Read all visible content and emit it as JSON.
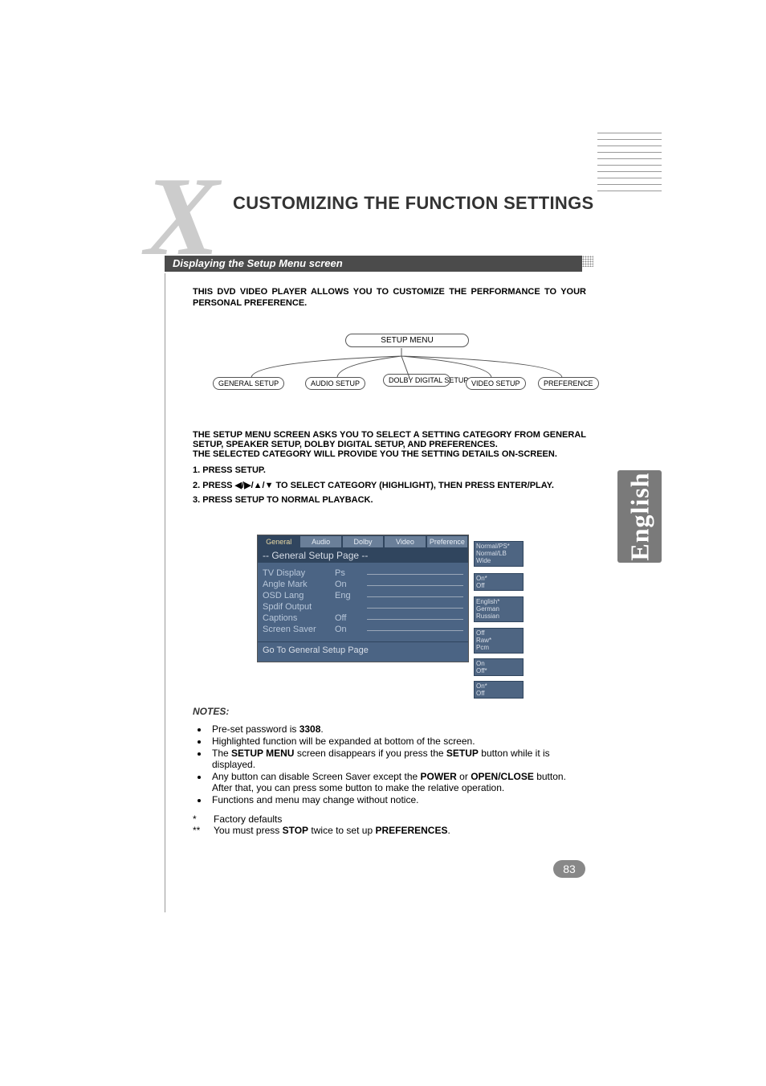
{
  "title": "CUSTOMIZING THE FUNCTION SETTINGS",
  "subtitle": "Displaying the Setup Menu screen",
  "intro": "THIS DVD VIDEO PLAYER ALLOWS YOU TO CUSTOMIZE THE PERFORMANCE TO YOUR PERSONAL PREFERENCE.",
  "tree": {
    "root": "SETUP MENU",
    "leaves": [
      "GENERAL SETUP",
      "AUDIO SETUP",
      "DOLBY DIGITAL SETUP",
      "VIDEO SETUP",
      "PREFERENCE"
    ]
  },
  "body": {
    "para1": "THE SETUP MENU SCREEN ASKS YOU TO SELECT A SETTING CATEGORY FROM GENERAL SETUP, SPEAKER SETUP, DOLBY DIGITAL SETUP, AND PREFERENCES.",
    "para2": "THE SELECTED CATEGORY WILL PROVIDE YOU THE SETTING DETAILS ON-SCREEN.",
    "step1": "1. PRESS SETUP.",
    "step2_pre": "2. PRESS ",
    "step2_post": " TO SELECT CATEGORY (HIGHLIGHT), THEN PRESS ENTER/PLAY.",
    "step3": "3. PRESS SETUP TO NORMAL PLAYBACK."
  },
  "ui": {
    "tabs": [
      "General",
      "Audio",
      "Dolby",
      "Video",
      "Preference"
    ],
    "header": "-- General Setup Page --",
    "rows": [
      {
        "label": "TV Display",
        "value": "Ps"
      },
      {
        "label": "Angle Mark",
        "value": "On"
      },
      {
        "label": "OSD Lang",
        "value": "Eng"
      },
      {
        "label": "Spdif Output",
        "value": ""
      },
      {
        "label": "Captions",
        "value": "Off"
      },
      {
        "label": "Screen Saver",
        "value": "On"
      }
    ],
    "footer": "Go To General Setup Page",
    "opts": [
      [
        "Normal/PS*",
        "Normal/LB",
        "Wide"
      ],
      [
        "On*",
        "Off"
      ],
      [
        "English*",
        "German",
        "Russian"
      ],
      [
        "Off",
        "Raw*",
        "Pcm"
      ],
      [
        "On",
        "Off*"
      ],
      [
        "On*",
        "Off"
      ]
    ]
  },
  "notes": {
    "head": "NOTES:",
    "items": [
      {
        "pre": "Pre-set password is ",
        "bold": "3308",
        "post": "."
      },
      {
        "pre": "Highlighted function will be expanded at bottom of the screen.",
        "bold": "",
        "post": ""
      },
      {
        "pre": "The ",
        "bold": "SETUP MENU",
        "mid": " screen disappears if you press the ",
        "bold2": "SETUP",
        "post": " button while it is displayed."
      },
      {
        "pre": "Any button can disable Screen Saver except the ",
        "bold": "POWER",
        "mid": " or ",
        "bold2": "OPEN/CLOSE",
        "post": " button. After that, you can press some button to make the relative operation."
      },
      {
        "pre": "Functions and menu may change without notice.",
        "bold": "",
        "post": ""
      }
    ],
    "defs": [
      {
        "mark": "*",
        "text": "Factory defaults"
      },
      {
        "mark": "**",
        "text_pre": "You must press ",
        "bold1": "STOP",
        "mid": " twice to set up ",
        "bold2": "PREFERENCES",
        "post": "."
      }
    ]
  },
  "side_tab": "English",
  "page_number": "83"
}
